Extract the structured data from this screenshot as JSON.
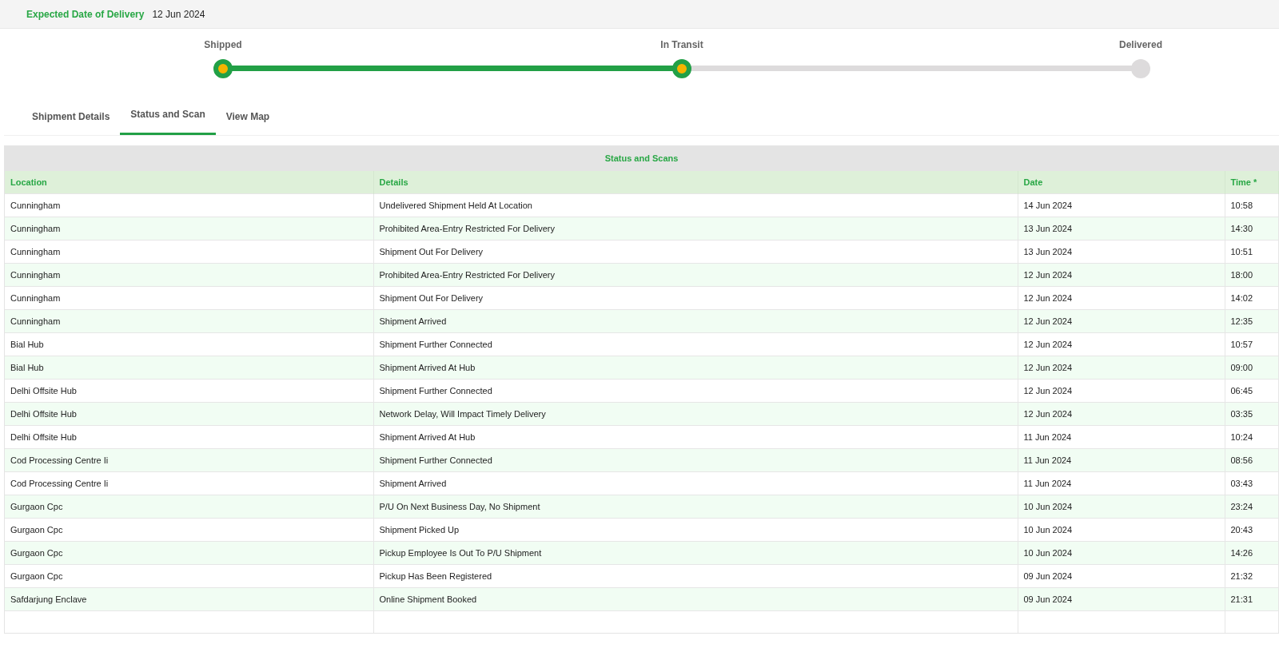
{
  "expected_delivery": {
    "label": "Expected Date of Delivery",
    "value": "12 Jun 2024"
  },
  "progress": [
    {
      "label": "Shipped",
      "reached": true
    },
    {
      "label": "In Transit",
      "reached": true
    },
    {
      "label": "Delivered",
      "reached": false
    }
  ],
  "tabs": [
    {
      "label": "Shipment Details",
      "selected": false
    },
    {
      "label": "Status and Scan",
      "selected": true
    },
    {
      "label": "View Map",
      "selected": false
    }
  ],
  "table": {
    "title": "Status and Scans",
    "columns": [
      "Location",
      "Details",
      "Date",
      "Time *"
    ],
    "rows": [
      [
        "Cunningham",
        "Undelivered Shipment Held At Location",
        "14 Jun 2024",
        "10:58"
      ],
      [
        "Cunningham",
        "Prohibited Area-Entry Restricted For Delivery",
        "13 Jun 2024",
        "14:30"
      ],
      [
        "Cunningham",
        "Shipment Out For Delivery",
        "13 Jun 2024",
        "10:51"
      ],
      [
        "Cunningham",
        "Prohibited Area-Entry Restricted For Delivery",
        "12 Jun 2024",
        "18:00"
      ],
      [
        "Cunningham",
        "Shipment Out For Delivery",
        "12 Jun 2024",
        "14:02"
      ],
      [
        "Cunningham",
        "Shipment Arrived",
        "12 Jun 2024",
        "12:35"
      ],
      [
        "Bial Hub",
        "Shipment Further Connected",
        "12 Jun 2024",
        "10:57"
      ],
      [
        "Bial Hub",
        "Shipment Arrived At Hub",
        "12 Jun 2024",
        "09:00"
      ],
      [
        "Delhi Offsite Hub",
        "Shipment Further Connected",
        "12 Jun 2024",
        "06:45"
      ],
      [
        "Delhi Offsite Hub",
        "Network Delay, Will Impact Timely Delivery",
        "12 Jun 2024",
        "03:35"
      ],
      [
        "Delhi Offsite Hub",
        "Shipment Arrived At Hub",
        "11 Jun 2024",
        "10:24"
      ],
      [
        "Cod Processing Centre Ii",
        "Shipment Further Connected",
        "11 Jun 2024",
        "08:56"
      ],
      [
        "Cod Processing Centre Ii",
        "Shipment Arrived",
        "11 Jun 2024",
        "03:43"
      ],
      [
        "Gurgaon Cpc",
        "P/U On Next Business Day, No Shipment",
        "10 Jun 2024",
        "23:24"
      ],
      [
        "Gurgaon Cpc",
        "Shipment Picked Up",
        "10 Jun 2024",
        "20:43"
      ],
      [
        "Gurgaon Cpc",
        "Pickup Employee Is Out To P/U Shipment",
        "10 Jun 2024",
        "14:26"
      ],
      [
        "Gurgaon Cpc",
        "Pickup Has Been Registered",
        "09 Jun 2024",
        "21:32"
      ],
      [
        "Safdarjung Enclave",
        "Online Shipment Booked",
        "09 Jun 2024",
        "21:31"
      ]
    ]
  }
}
